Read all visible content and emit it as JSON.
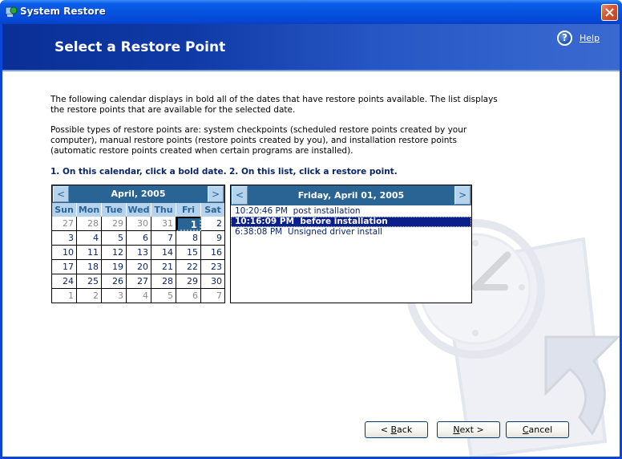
{
  "window": {
    "title": "System Restore",
    "app_icon": "system-restore-icon",
    "close_icon": "close-icon"
  },
  "header": {
    "page_title": "Select a Restore Point",
    "help_label": "Help",
    "help_icon": "help-icon",
    "help_glyph": "?"
  },
  "description": {
    "paragraph1": "The following calendar displays in bold all of the dates that have restore points available. The list displays the restore points that are available for the selected date.",
    "paragraph2": "Possible types of restore points are: system checkpoints (scheduled restore points created by your computer), manual restore points (restore points created by you), and installation restore points (automatic restore points created when certain programs are installed)."
  },
  "steps": {
    "step1": "1. On this calendar, click a bold date.",
    "step2": "2. On this list, click a restore point."
  },
  "calendar": {
    "month_label": "April, 2005",
    "prev_label": "<",
    "next_label": ">",
    "days_of_week": [
      "Sun",
      "Mon",
      "Tue",
      "Wed",
      "Thu",
      "Fri",
      "Sat"
    ],
    "selected_day": "1",
    "weeks": [
      [
        {
          "d": "27",
          "other": true
        },
        {
          "d": "28",
          "other": true
        },
        {
          "d": "29",
          "other": true
        },
        {
          "d": "30",
          "other": true
        },
        {
          "d": "31",
          "other": true
        },
        {
          "d": "1",
          "selected": true
        },
        {
          "d": "2"
        }
      ],
      [
        {
          "d": "3"
        },
        {
          "d": "4"
        },
        {
          "d": "5"
        },
        {
          "d": "6"
        },
        {
          "d": "7"
        },
        {
          "d": "8"
        },
        {
          "d": "9"
        }
      ],
      [
        {
          "d": "10"
        },
        {
          "d": "11"
        },
        {
          "d": "12"
        },
        {
          "d": "13"
        },
        {
          "d": "14"
        },
        {
          "d": "15"
        },
        {
          "d": "16"
        }
      ],
      [
        {
          "d": "17"
        },
        {
          "d": "18"
        },
        {
          "d": "19"
        },
        {
          "d": "20"
        },
        {
          "d": "21"
        },
        {
          "d": "22"
        },
        {
          "d": "23"
        }
      ],
      [
        {
          "d": "24"
        },
        {
          "d": "25"
        },
        {
          "d": "26"
        },
        {
          "d": "27"
        },
        {
          "d": "28"
        },
        {
          "d": "29"
        },
        {
          "d": "30"
        }
      ],
      [
        {
          "d": "1",
          "other": true
        },
        {
          "d": "2",
          "other": true
        },
        {
          "d": "3",
          "other": true
        },
        {
          "d": "4",
          "other": true
        },
        {
          "d": "5",
          "other": true
        },
        {
          "d": "6",
          "other": true
        },
        {
          "d": "7",
          "other": true
        }
      ]
    ]
  },
  "restore_list": {
    "date_label": "Friday, April 01, 2005",
    "prev_label": "<",
    "next_label": ">",
    "items": [
      {
        "time": "10:20:46 PM",
        "description": "post installation",
        "selected": false
      },
      {
        "time": "10:16:09 PM",
        "description": "before installation",
        "selected": true
      },
      {
        "time": "6:38:08 PM",
        "description": "Unsigned driver install",
        "selected": false
      }
    ]
  },
  "buttons": {
    "back": {
      "prefix": "< ",
      "mnemonic": "B",
      "rest": "ack"
    },
    "next": {
      "prefix": "",
      "mnemonic": "N",
      "rest": "ext >"
    },
    "cancel": {
      "prefix": "",
      "mnemonic": "C",
      "rest": "ancel"
    }
  },
  "colors": {
    "title_bar": "#0654e0",
    "header_dark": "#0a2f96",
    "calendar_header": "#2a6495",
    "calendar_dow": "#b6d3ee",
    "step_text": "#0a246a",
    "list_selection": "#0a1f8a",
    "close_button": "#d9532e"
  }
}
